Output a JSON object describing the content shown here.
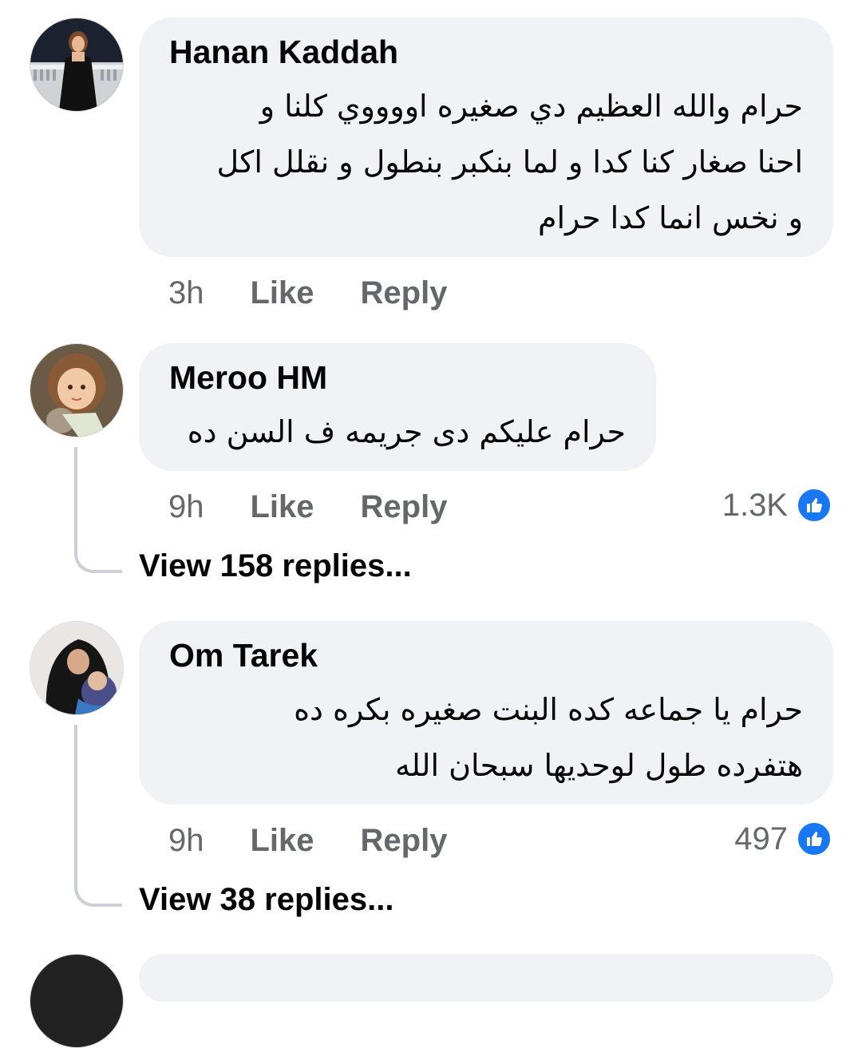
{
  "comments": [
    {
      "author": "Hanan Kaddah",
      "lines": [
        "حرام والله العظيم دي صغيره اووووي كلنا و",
        "احنا صغار كنا كدا و لما بنكبر بنطول و نقلل اكل",
        "و نخس انما كدا حرام"
      ],
      "time": "3h",
      "like": "Like",
      "reply": "Reply"
    },
    {
      "author": "Meroo HM",
      "lines": [
        "حرام عليكم دى جريمه ف السن ده"
      ],
      "time": "9h",
      "like": "Like",
      "reply": "Reply",
      "reaction_count": "1.3K",
      "view_replies": "View 158 replies..."
    },
    {
      "author": "Om Tarek",
      "lines": [
        "حرام يا جماعه كده البنت صغيره بكره ده",
        "هتفرده طول لوحديها سبحان الله"
      ],
      "time": "9h",
      "like": "Like",
      "reply": "Reply",
      "reaction_count": "497",
      "view_replies": "View 38 replies..."
    }
  ],
  "colors": {
    "bubble": "#f0f2f5",
    "like_blue": "#1877f2",
    "meta_gray": "#65676b"
  },
  "icons": [
    "like-reaction-icon"
  ]
}
